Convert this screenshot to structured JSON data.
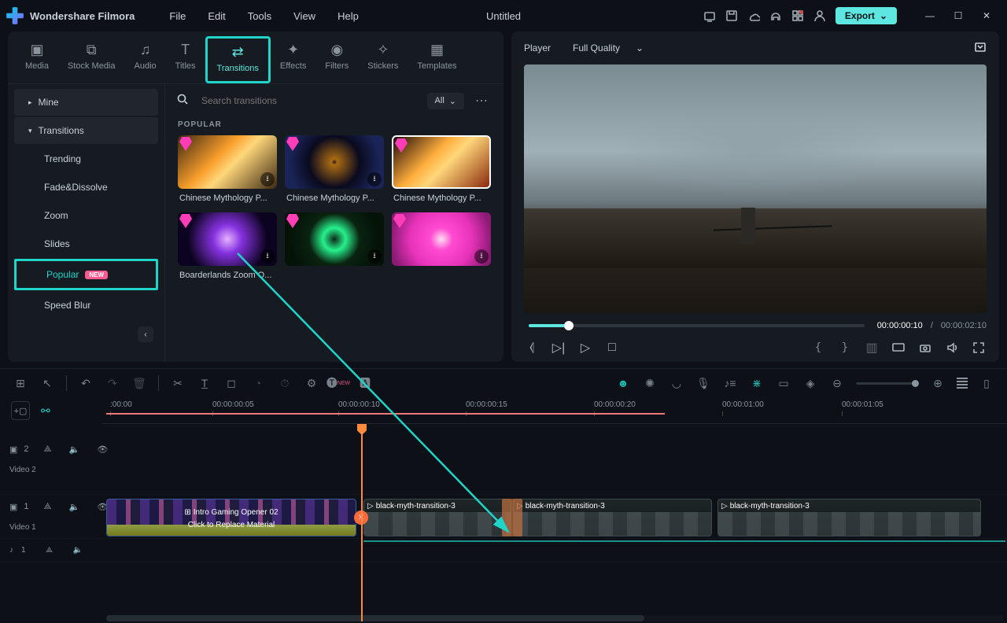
{
  "app": {
    "name": "Wondershare Filmora",
    "document": "Untitled"
  },
  "menubar": [
    "File",
    "Edit",
    "Tools",
    "View",
    "Help"
  ],
  "export_label": "Export",
  "tabs": [
    {
      "id": "media",
      "label": "Media"
    },
    {
      "id": "stock",
      "label": "Stock Media"
    },
    {
      "id": "audio",
      "label": "Audio"
    },
    {
      "id": "titles",
      "label": "Titles"
    },
    {
      "id": "transitions",
      "label": "Transitions"
    },
    {
      "id": "effects",
      "label": "Effects"
    },
    {
      "id": "filters",
      "label": "Filters"
    },
    {
      "id": "stickers",
      "label": "Stickers"
    },
    {
      "id": "templates",
      "label": "Templates"
    }
  ],
  "sidebar": {
    "mine": "Mine",
    "transitions": "Transitions",
    "items": [
      "Trending",
      "Fade&Dissolve",
      "Zoom",
      "Slides",
      "Popular",
      "Speed Blur"
    ],
    "new_badge": "NEW"
  },
  "search": {
    "placeholder": "Search transitions",
    "filter": "All"
  },
  "section": "POPULAR",
  "cards": [
    "Chinese Mythology P...",
    "Chinese Mythology P...",
    "Chinese Mythology P...",
    "Boarderlands Zoom O..."
  ],
  "player": {
    "label": "Player",
    "quality": "Full Quality",
    "current": "00:00:00:10",
    "duration": "00:00:02:10",
    "slash": "/"
  },
  "ruler": [
    ":00:00",
    "00:00:00:05",
    "00:00:00:10",
    "00:00:00:15",
    "00:00:00:20",
    "00:00:01:00",
    "00:00:01:05"
  ],
  "tracks": {
    "v2": {
      "id": "2",
      "name": "Video 2"
    },
    "v1": {
      "id": "1",
      "name": "Video 1"
    },
    "a1": {
      "id": "1"
    }
  },
  "clips": {
    "c1_title": "Intro Gaming Opener 02",
    "c1_hint": "Click to Replace Material",
    "c2": "black-myth-transition-3",
    "c3": "black-myth-transition-3",
    "c4": "black-myth-transition-3"
  }
}
